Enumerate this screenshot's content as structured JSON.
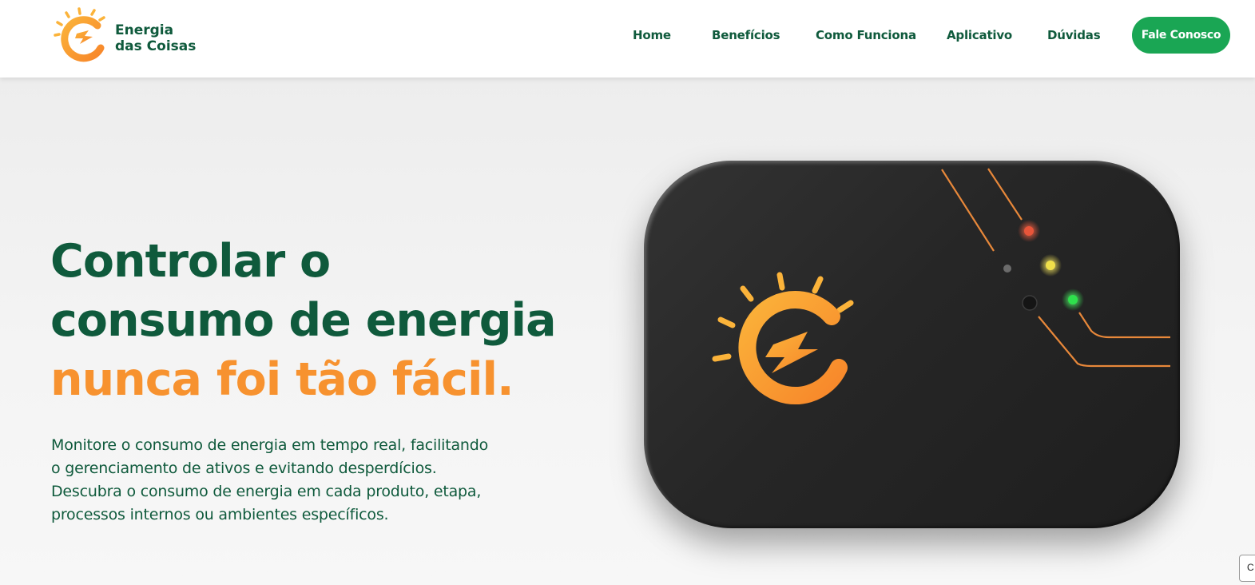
{
  "brand": {
    "line1": "Energia",
    "line2": "das Coisas",
    "logo_icon": "sun-bolt-logo-icon",
    "colors": {
      "primary_green": "#0f5a3c",
      "accent_orange": "#f7922f",
      "cta_green": "#1aa654"
    }
  },
  "nav": {
    "items": [
      {
        "label": "Home"
      },
      {
        "label": "Benefícios"
      },
      {
        "label": "Como Funciona"
      },
      {
        "label": "Aplicativo"
      },
      {
        "label": "Dúvidas"
      }
    ],
    "cta_label": "Fale Conosco"
  },
  "hero": {
    "title_line1": "Controlar o",
    "title_line2": "consumo de energia",
    "title_line3": "nunca foi tão fácil.",
    "desc_line1": "Monitore o consumo de energia em tempo real, facilitando",
    "desc_line2": "o gerenciamento de ativos e evitando desperdícios.",
    "desc_line3": "Descubra o consumo de energia em cada produto, etapa,",
    "desc_line4": "processos internos ou ambientes específicos."
  },
  "device": {
    "led_colors": [
      "#e8553a",
      "#f0e04a",
      "#2ee04c"
    ]
  },
  "corner_widget": {
    "label": "C"
  }
}
